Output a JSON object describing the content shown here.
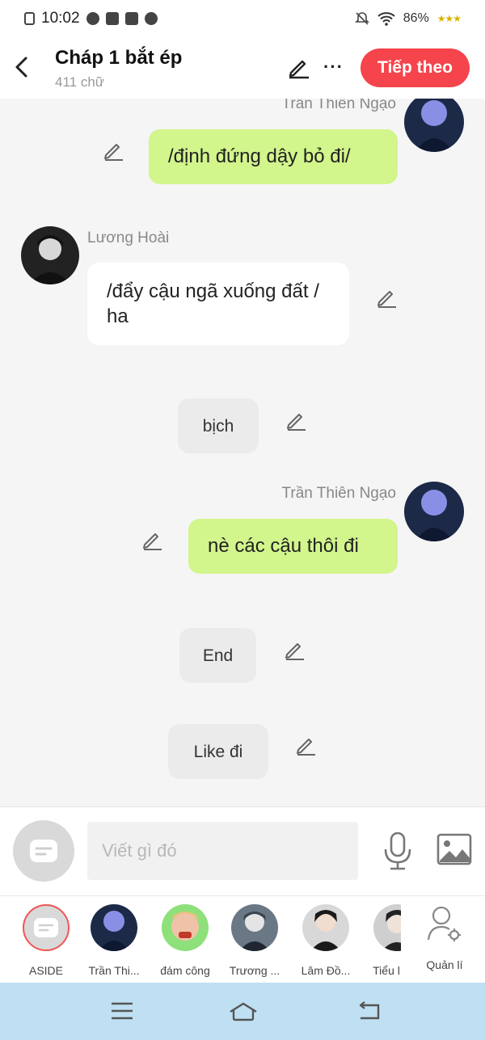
{
  "status_bar": {
    "time": "10:02",
    "battery": "86%"
  },
  "header": {
    "title": "Cháp 1 bắt ép",
    "word_count": "411 chữ",
    "next_label": "Tiếp theo"
  },
  "messages": [
    {
      "sender": "Trần Thiên Ngạo",
      "text": "/định đứng dậy bỏ đi/"
    },
    {
      "sender": "Lương Hoài",
      "text": "/đẩy cậu ngã xuống đất / ha"
    },
    {
      "text": "bịch"
    },
    {
      "sender": "Trần Thiên Ngạo",
      "text": "nè các cậu thôi đi"
    },
    {
      "text": "End"
    },
    {
      "text": "Like đi"
    }
  ],
  "composer": {
    "placeholder": "Viết gì đó"
  },
  "characters": [
    {
      "label": "ASIDE"
    },
    {
      "label": "Trần Thi..."
    },
    {
      "label": "đám công"
    },
    {
      "label": "Trương ..."
    },
    {
      "label": "Lâm Đồ..."
    },
    {
      "label": "Tiểu l"
    }
  ],
  "manage_label": "Quản lí",
  "colors": {
    "accent": "#f5444b",
    "green_bubble": "#d2f58c",
    "nav_bar": "#bfe0f2"
  }
}
